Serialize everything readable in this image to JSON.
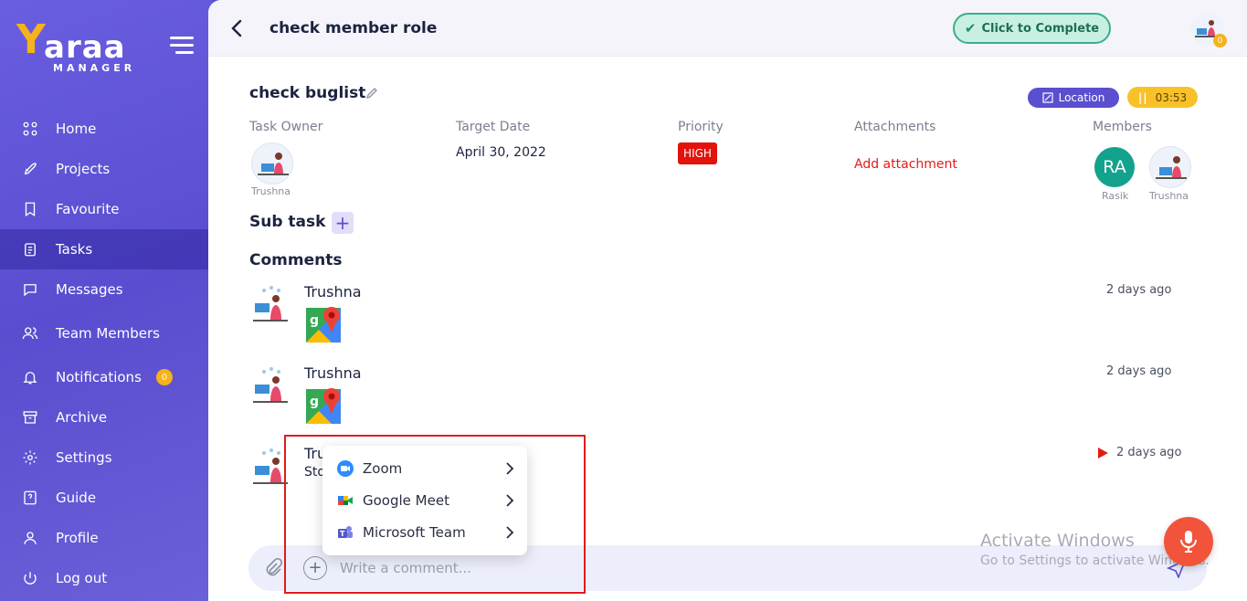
{
  "sidebar": {
    "logo_word": "araa",
    "logo_sub": "MANAGER",
    "items": [
      {
        "label": "Home",
        "icon": "grid-icon"
      },
      {
        "label": "Projects",
        "icon": "rocket-icon"
      },
      {
        "label": "Favourite",
        "icon": "bookmark-icon"
      },
      {
        "label": "Tasks",
        "icon": "clipboard-icon"
      },
      {
        "label": "Messages",
        "icon": "chat-icon"
      },
      {
        "label": "Team Members",
        "icon": "users-icon"
      },
      {
        "label": "Notifications",
        "icon": "bell-icon"
      },
      {
        "label": "Archive",
        "icon": "archive-icon"
      },
      {
        "label": "Settings",
        "icon": "gear-icon"
      },
      {
        "label": "Guide",
        "icon": "help-icon"
      },
      {
        "label": "Profile",
        "icon": "user-icon"
      },
      {
        "label": "Log out",
        "icon": "power-icon"
      }
    ],
    "notifications_count": "0",
    "active": "Tasks"
  },
  "header": {
    "title": "check member role",
    "complete_label": "Click to Complete",
    "avatar_count": "0"
  },
  "task": {
    "title": "check buglist",
    "location_label": "Location",
    "timer": "03:53",
    "labels": {
      "owner": "Task Owner",
      "target_date": "Target Date",
      "priority": "Priority",
      "attachments": "Attachments",
      "members": "Members"
    },
    "owner_name": "Trushna",
    "target_date": "April 30, 2022",
    "priority": "HIGH",
    "add_attachment": "Add attachment",
    "members": [
      {
        "initials": "RA",
        "name": "Rasik"
      },
      {
        "name": "Trushna"
      }
    ]
  },
  "subtask": {
    "title": "Sub task"
  },
  "comments": {
    "title": "Comments",
    "items": [
      {
        "name": "Trushna",
        "time": "2 days ago"
      },
      {
        "name": "Trushna",
        "time": "2 days ago"
      },
      {
        "name": "Tru",
        "sub": "Sto",
        "time": "2 days ago"
      }
    ],
    "placeholder": "Write a comment..."
  },
  "popup": {
    "items": [
      {
        "label": "Zoom"
      },
      {
        "label": "Google Meet"
      },
      {
        "label": "Microsoft Team"
      }
    ]
  },
  "watermark": {
    "title": "Activate Windows",
    "sub": "Go to Settings to activate Windows."
  },
  "colors": {
    "sidebar": "#5b4fd0",
    "accent_yellow": "#f6b21a",
    "priority_red": "#e3120b",
    "complete_green": "#3aae86",
    "highlight": "#e11b1b"
  }
}
